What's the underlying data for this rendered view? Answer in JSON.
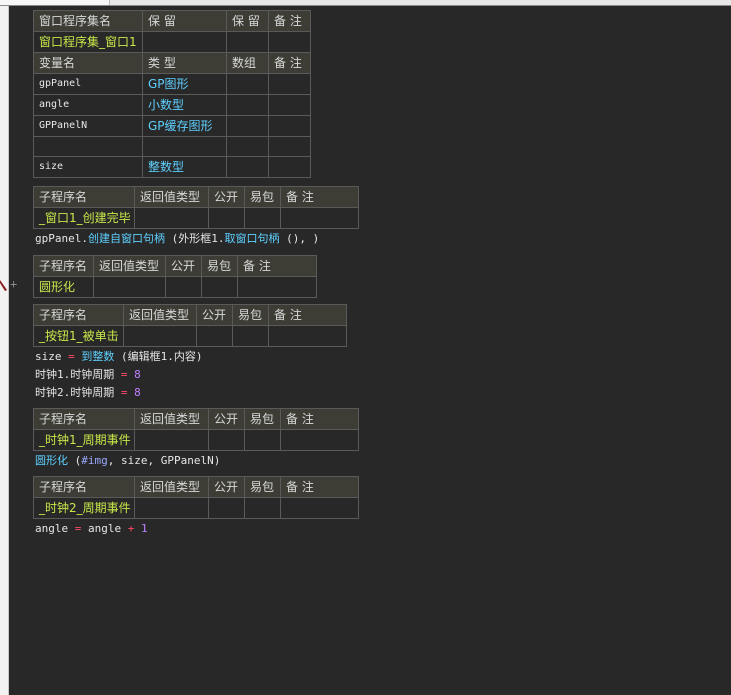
{
  "header_table": {
    "headers": [
      "窗口程序集名",
      "保 留",
      "保 留",
      "备 注"
    ],
    "row": [
      "窗口程序集_窗口1",
      "",
      "",
      ""
    ],
    "var_headers": [
      "变量名",
      "类 型",
      "数组",
      "备 注"
    ],
    "vars": [
      {
        "name": "gpPanel",
        "type": "GP图形",
        "array": "",
        "note": ""
      },
      {
        "name": "angle",
        "type": "小数型",
        "array": "",
        "note": ""
      },
      {
        "name": "GPPanelN",
        "type": "GP缓存图形",
        "array": "",
        "note": ""
      },
      {
        "name": "",
        "type": "",
        "array": "",
        "note": ""
      },
      {
        "name": "size",
        "type": "整数型",
        "array": "",
        "note": ""
      }
    ]
  },
  "sub_headers": [
    "子程序名",
    "返回值类型",
    "公开",
    "易包",
    "备 注"
  ],
  "subs": [
    {
      "name": "_窗口1_创建完毕"
    },
    {
      "name": "圆形化"
    },
    {
      "name": "_按钮1_被单击"
    },
    {
      "name": "_时钟1_周期事件"
    },
    {
      "name": "_时钟2_周期事件"
    }
  ],
  "code": {
    "l1": {
      "a": "gpPanel.",
      "b": "创建自窗口句柄",
      "c": " (外形框1.",
      "d": "取窗口句柄",
      "e": " (), )"
    },
    "l2": {
      "a": "size",
      "b": " = ",
      "c": "到整数",
      "d": " (编辑框1.内容)"
    },
    "l3": {
      "a": "时钟1.时钟周期",
      "b": " = ",
      "c": "8"
    },
    "l4": {
      "a": "时钟2.时钟周期",
      "b": " = ",
      "c": "8"
    },
    "l5": {
      "a": "圆形化",
      "b": " (",
      "c": "#img",
      "d": ", size, GPPanelN)"
    },
    "l6": {
      "a": "angle",
      "b": " = ",
      "c": "angle",
      "d": " + ",
      "e": "1"
    }
  },
  "gutter_mark": "+",
  "colors": {
    "background": "#282828",
    "header": "#3d3d36",
    "name": "#c8e84a",
    "type": "#5ed0ff",
    "operator": "#ff4a6a",
    "number": "#c080ff"
  }
}
